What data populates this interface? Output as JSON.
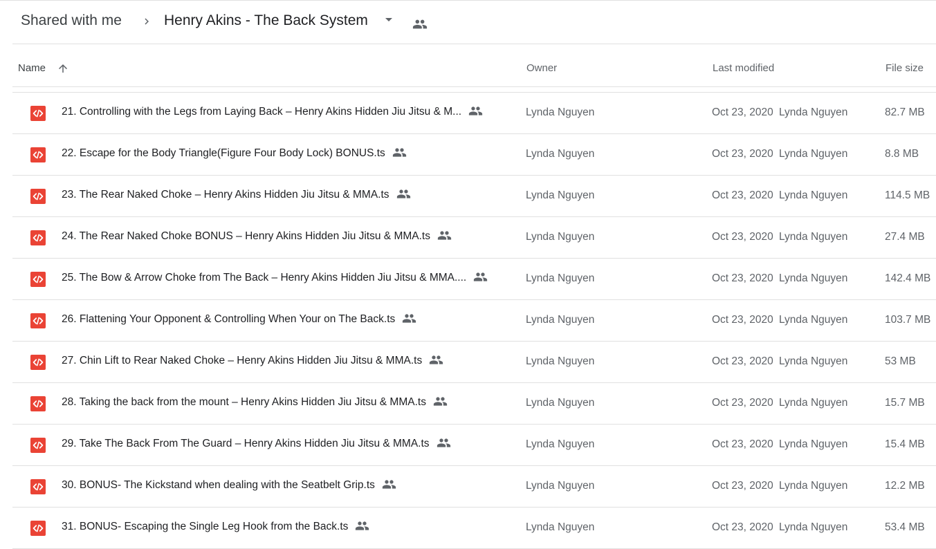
{
  "breadcrumb": {
    "root_label": "Shared with me",
    "separator_icon": "chevron-right-icon",
    "current_label": "Henry Akins - The Back System",
    "caret_icon": "caret-down-icon",
    "shared_icon": "people-icon"
  },
  "columns": {
    "name": "Name",
    "sort_icon": "arrow-up-icon",
    "owner": "Owner",
    "last_modified": "Last modified",
    "file_size": "File size"
  },
  "colors": {
    "file_icon_red": "#ea4335",
    "shared_icon_gray": "#5f6368",
    "divider": "#e0e0e0"
  },
  "files": [
    {
      "name": "21. Controlling with the Legs from Laying Back – Henry Akins Hidden Jiu Jitsu & M...",
      "owner": "Lynda Nguyen",
      "modified_date": "Oct 23, 2020",
      "modified_by": "Lynda Nguyen",
      "size": "82.7 MB"
    },
    {
      "name": "22. Escape for the Body Triangle(Figure Four Body Lock) BONUS.ts",
      "owner": "Lynda Nguyen",
      "modified_date": "Oct 23, 2020",
      "modified_by": "Lynda Nguyen",
      "size": "8.8 MB"
    },
    {
      "name": "23. The Rear Naked Choke – Henry Akins Hidden Jiu Jitsu & MMA.ts",
      "owner": "Lynda Nguyen",
      "modified_date": "Oct 23, 2020",
      "modified_by": "Lynda Nguyen",
      "size": "114.5 MB"
    },
    {
      "name": "24. The Rear Naked Choke BONUS – Henry Akins Hidden Jiu Jitsu & MMA.ts",
      "owner": "Lynda Nguyen",
      "modified_date": "Oct 23, 2020",
      "modified_by": "Lynda Nguyen",
      "size": "27.4 MB"
    },
    {
      "name": "25. The Bow & Arrow Choke from The Back – Henry Akins Hidden Jiu Jitsu & MMA....",
      "owner": "Lynda Nguyen",
      "modified_date": "Oct 23, 2020",
      "modified_by": "Lynda Nguyen",
      "size": "142.4 MB"
    },
    {
      "name": "26. Flattening Your Opponent & Controlling When Your on The Back.ts",
      "owner": "Lynda Nguyen",
      "modified_date": "Oct 23, 2020",
      "modified_by": "Lynda Nguyen",
      "size": "103.7 MB"
    },
    {
      "name": "27. Chin Lift to Rear Naked Choke – Henry Akins Hidden Jiu Jitsu & MMA.ts",
      "owner": "Lynda Nguyen",
      "modified_date": "Oct 23, 2020",
      "modified_by": "Lynda Nguyen",
      "size": "53 MB"
    },
    {
      "name": "28. Taking the back from the mount – Henry Akins Hidden Jiu Jitsu & MMA.ts",
      "owner": "Lynda Nguyen",
      "modified_date": "Oct 23, 2020",
      "modified_by": "Lynda Nguyen",
      "size": "15.7 MB"
    },
    {
      "name": "29. Take The Back From The Guard – Henry Akins Hidden Jiu Jitsu & MMA.ts",
      "owner": "Lynda Nguyen",
      "modified_date": "Oct 23, 2020",
      "modified_by": "Lynda Nguyen",
      "size": "15.4 MB"
    },
    {
      "name": "30. BONUS- The Kickstand when dealing with the Seatbelt Grip.ts",
      "owner": "Lynda Nguyen",
      "modified_date": "Oct 23, 2020",
      "modified_by": "Lynda Nguyen",
      "size": "12.2 MB"
    },
    {
      "name": "31. BONUS- Escaping the Single Leg Hook from the Back.ts",
      "owner": "Lynda Nguyen",
      "modified_date": "Oct 23, 2020",
      "modified_by": "Lynda Nguyen",
      "size": "53.4 MB"
    }
  ]
}
